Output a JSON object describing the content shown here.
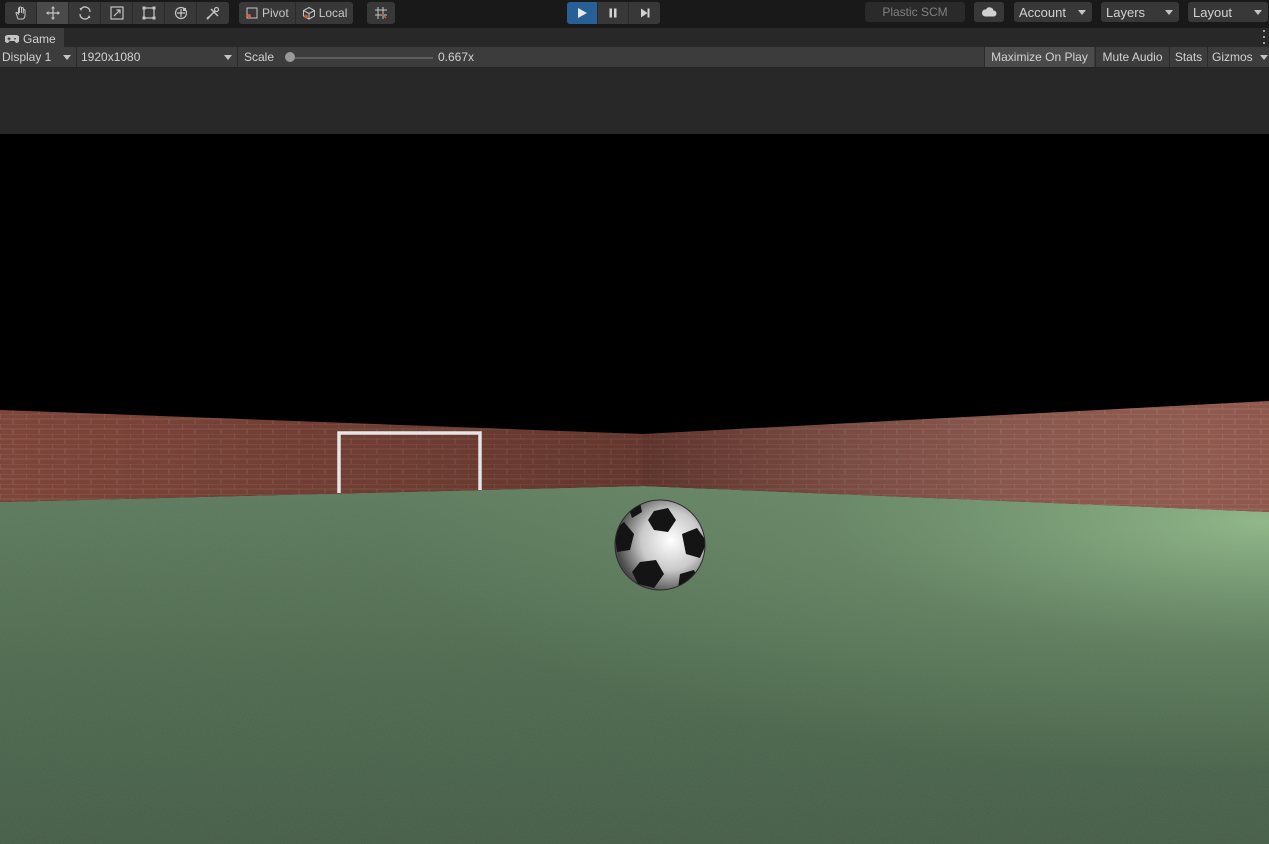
{
  "toolbar": {
    "tools": [
      {
        "name": "hand-tool",
        "icon": "hand-icon",
        "active": false
      },
      {
        "name": "move-tool",
        "icon": "move-icon",
        "active": true
      },
      {
        "name": "rotate-tool",
        "icon": "rotate-icon",
        "active": false
      },
      {
        "name": "scale-tool",
        "icon": "scale-icon",
        "active": false
      },
      {
        "name": "rect-tool",
        "icon": "rect-icon",
        "active": false
      },
      {
        "name": "transform-tool",
        "icon": "transform-icon",
        "active": false
      },
      {
        "name": "custom-tool",
        "icon": "tools-icon",
        "active": false
      }
    ],
    "pivot_label": "Pivot",
    "local_label": "Local",
    "play_state": "playing",
    "plastic_scm_label": "Plastic SCM",
    "account_label": "Account",
    "layers_label": "Layers",
    "layout_label": "Layout"
  },
  "tab": {
    "title": "Game"
  },
  "game_toolbar": {
    "display": "Display 1",
    "resolution": "1920x1080",
    "scale_label": "Scale",
    "scale_value": "0.667x",
    "scale_fraction": 0.02,
    "maximize_on_play": "Maximize On Play",
    "mute_audio": "Mute Audio",
    "stats": "Stats",
    "gizmos": "Gizmos"
  },
  "colors": {
    "play_active": "#275f96",
    "panel_bg": "#3c3c3c",
    "toolbar_bg": "#191919",
    "grass": "#4f6e50",
    "brick": "#8a4f42"
  }
}
